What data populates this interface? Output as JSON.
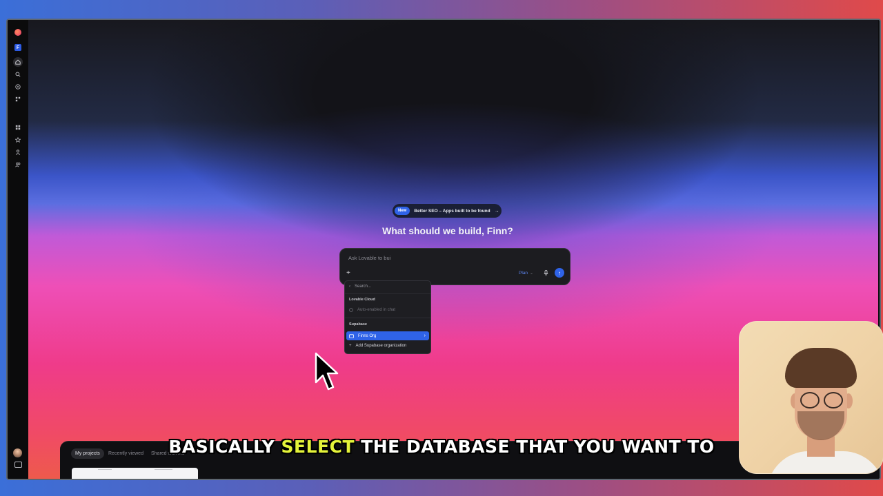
{
  "announcement": {
    "badge": "New",
    "text": "Better SEO – Apps built to be found",
    "arrow": "→"
  },
  "headline": "What should we build, Finn?",
  "prompt": {
    "placeholder": "Ask Lovable to bui",
    "plus": "+",
    "plan_label": "Plan",
    "plan_caret": "⌄",
    "send": "↑",
    "mic": "🎙"
  },
  "dropdown": {
    "search_placeholder": "Search...",
    "sections": [
      {
        "heading": "Lovable Cloud"
      },
      {
        "heading": "Supabase"
      }
    ],
    "cloud_item": "Auto-enabled in chat",
    "selected_org": "Finns Org",
    "add_org": "Add Supabase organization"
  },
  "bottom_tabs": [
    "My projects",
    "Recently viewed",
    "Shared with me"
  ],
  "caption": {
    "before": "BASICALLY ",
    "highlight": "SELECT",
    "after": " THE DATABASE THAT YOU WANT TO"
  },
  "colors": {
    "accent": "#2f63e8",
    "caption_highlight": "#e4f33a"
  },
  "icons": {
    "sidebar": [
      "lovable-logo",
      "workspace-badge",
      "home-icon",
      "search-icon",
      "compass-icon",
      "connect-icon",
      "grid-icon",
      "star-icon",
      "user-icon",
      "users-icon"
    ]
  },
  "workspace_letter": "F"
}
